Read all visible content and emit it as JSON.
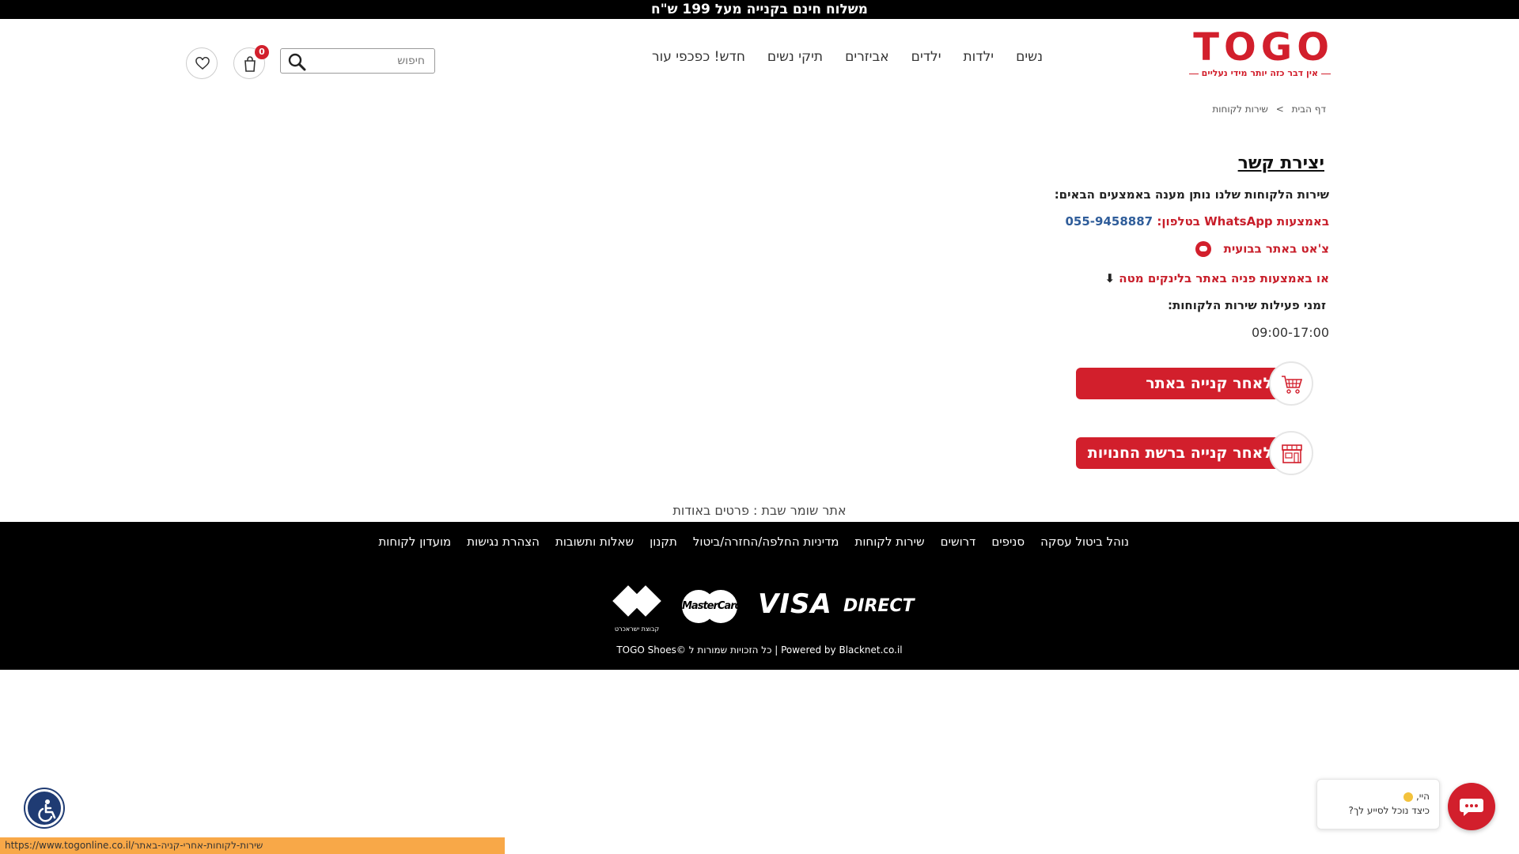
{
  "promo": {
    "text": "משלוח חינם בקנייה מעל 199 ש\"ח"
  },
  "header": {
    "logo_text": "TOGO",
    "logo_tagline": "אין דבר כזה יותר מידי נעליים",
    "nav": [
      "נשים",
      "ילדות",
      "ילדים",
      "אביזרים",
      "תיקי נשים",
      "חדש! כפכפי עור"
    ],
    "search_placeholder": "חיפוש",
    "cart_count": "0"
  },
  "breadcrumb": {
    "home": "דף הבית",
    "separator": ">",
    "current": "שירות לקוחות"
  },
  "content": {
    "title": "יצירת קשר",
    "intro": "שירות הלקוחות שלנו נותן מענה באמצעים הבאים:",
    "whatsapp_label": "באמצעות WhatsApp בטלפון:",
    "whatsapp_phone": "055-9458887",
    "chat_label": "צ'אט באתר בבועית",
    "links_label": "או באמצעות פניה באתר בלינקים מטה",
    "links_arrow": "⬇",
    "hours_title": "זמני פעילות שירות הלקוחות:",
    "hours": "09:00-17:00",
    "cta_online": "לאחר קנייה באתר",
    "cta_store": "לאחר קנייה ברשת החנויות"
  },
  "shabbat": "אתר שומר שבת : פרטים באודות",
  "footer": {
    "links": [
      "נוהל ביטול עסקה",
      "סניפים",
      "דרושים",
      "שירות לקוחות",
      "מדיניות החלפה/החזרה/ביטול",
      "תקנון",
      "שאלות ותשובות",
      "הצהרת נגישות",
      "מועדון לקוחות"
    ],
    "payments": {
      "isracard": "קבוצת ישראכרט",
      "mastercard": "MasterCard",
      "visa": "VISA",
      "direct": "DIRECT"
    },
    "copyright": "TOGO Shoes© כל הזכויות שמורות ל | Powered by Blacknet.co.il"
  },
  "chat_widget": {
    "greeting": "היי",
    "question": "כיצד נוכל לסייע לך?"
  },
  "status_bar": {
    "url": "https://www.togonline.co.il/שירות-לקוחות-אחרי-קניה-באתר"
  },
  "colors": {
    "brand_red": "#d21f2c",
    "phone_blue": "#2f5d9a",
    "footer_bg": "#000000",
    "status_orange": "#f8a848"
  },
  "icons": [
    "search-icon",
    "cart-icon",
    "heart-icon",
    "cart-cta-icon",
    "store-cta-icon",
    "accessibility-icon",
    "chat-icon"
  ]
}
